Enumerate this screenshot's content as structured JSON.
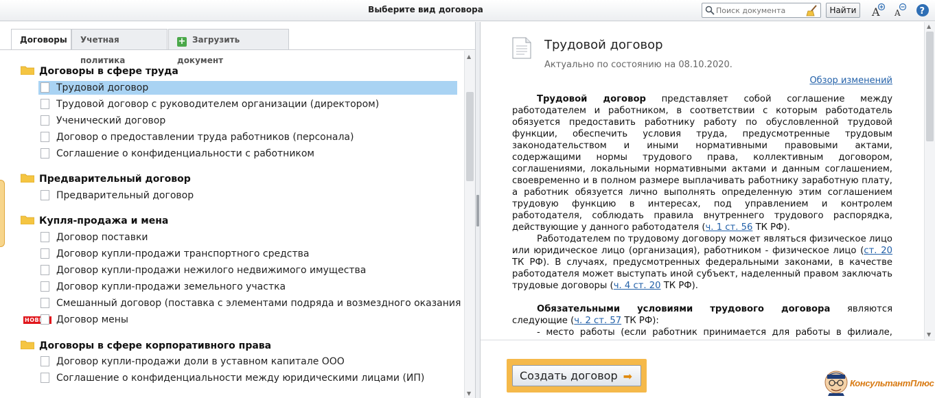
{
  "window": {
    "title": "Выберите вид договора"
  },
  "search": {
    "placeholder": "Поиск документа",
    "value": "",
    "find_label": "Найти"
  },
  "tabs": [
    {
      "label": "Договоры",
      "active": true
    },
    {
      "label": "Учетная политика",
      "active": false
    },
    {
      "label": "Загрузить документ",
      "active": false
    }
  ],
  "tree": [
    {
      "label": "Договоры в сфере труда",
      "items": [
        {
          "label": "Трудовой договор",
          "selected": true
        },
        {
          "label": "Трудовой договор с руководителем организации (директором)"
        },
        {
          "label": "Ученический договор"
        },
        {
          "label": "Договор о предоставлении труда работников (персонала)"
        },
        {
          "label": "Соглашение о конфиденциальности с работником"
        }
      ]
    },
    {
      "label": "Предварительный договор",
      "items": [
        {
          "label": "Предварительный договор"
        }
      ]
    },
    {
      "label": "Купля-продажа и мена",
      "items": [
        {
          "label": "Договор поставки"
        },
        {
          "label": "Договор купли-продажи транспортного средства"
        },
        {
          "label": "Договор купли-продажи нежилого недвижимого имущества"
        },
        {
          "label": "Договор купли-продажи земельного участка"
        },
        {
          "label": "Смешанный договор (поставка с элементами подряда и возмездного оказания услуг)"
        },
        {
          "label": "Договор мены",
          "badge": "НОВЫЙ"
        }
      ]
    },
    {
      "label": "Договоры в сфере корпоративного права",
      "items": [
        {
          "label": "Договор купли-продажи доли в уставном капитале ООО"
        },
        {
          "label": "Соглашение о конфиденциальности между юридическими лицами (ИП)"
        }
      ]
    }
  ],
  "document": {
    "title": "Трудовой договор",
    "date": "Актуально по состоянию на 08.10.2020.",
    "changes_link": "Обзор изменений",
    "p1_bold": "Трудовой договор",
    "p1_text": " представляет собой соглашение между работодателем и работником, в соответствии с которым работодатель обязуется предоставить работнику работу по обусловленной трудовой функции, обеспечить условия труда, предусмотренные трудовым законодательством и иными нормативными правовыми актами, содержащими нормы трудового права, коллективным договором, соглашениями, локальными нормативными актами и данным соглашением, своевременно и в полном размере выплачивать работнику заработную плату, а работник обязуется лично выполнять определенную этим соглашением трудовую функцию в интересах, под управлением и контролем работодателя, соблюдать правила внутреннего трудового распорядка, действующие у данного работодателя (",
    "p1_link": "ч. 1 ст. 56",
    "p1_end": " ТК РФ).",
    "p2_text": "Работодателем по трудовому договору может являться физическое лицо или юридическое лицо (организация), работником - физическое лицо (",
    "p2_link1": "ст. 20",
    "p2_mid": " ТК РФ). В случаях, предусмотренных федеральными законами, в качестве работодателя может выступать иной субъект, наделенный правом заключать трудовые договоры (",
    "p2_link2": "ч. 4 ст. 20",
    "p2_end": " ТК РФ).",
    "p3_bold": "Обязательными условиями трудового договора",
    "p3_text": " являются следующие (",
    "p3_link": "ч. 2 ст. 57",
    "p3_end": " ТК РФ):",
    "p4_text": "- место работы (если работник принимается для работы в филиале, представительстве или ином обособленном структурном подразделении"
  },
  "create_button": {
    "label": "Создать договор"
  },
  "logo": {
    "brand": "КонсультантПлюс"
  },
  "colors": {
    "selection": "#a9d3f3",
    "link": "#2361a9",
    "accent": "#f5b94a",
    "badge": "#e0161c"
  }
}
